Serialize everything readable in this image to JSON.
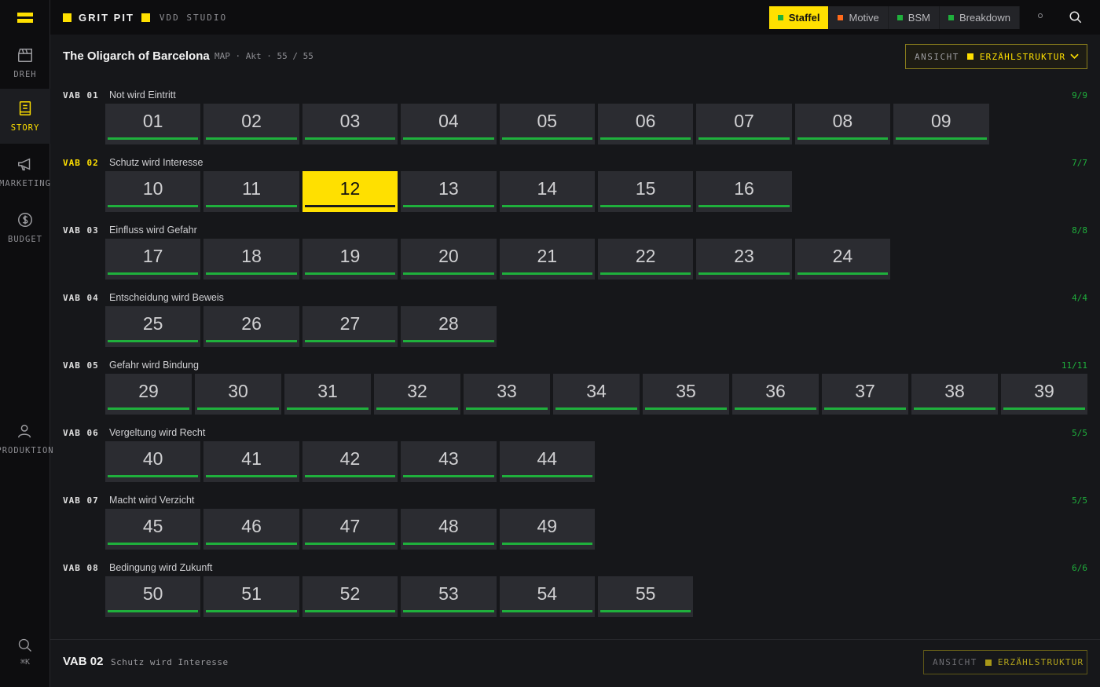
{
  "app": {
    "brand": "GRIT PIT",
    "studio": "VDD STUDIO"
  },
  "sidebar": {
    "items": [
      {
        "label": "DREH",
        "icon": "clapperboard-icon"
      },
      {
        "label": "STORY",
        "icon": "book-icon",
        "active": true
      },
      {
        "label": "MARKETING",
        "icon": "megaphone-icon"
      },
      {
        "label": "BUDGET",
        "icon": "dollar-circle-icon"
      },
      {
        "label": "PRODUKTION",
        "icon": "user-icon"
      }
    ],
    "search_label": "⌘K"
  },
  "tabs": [
    {
      "label": "Staffel",
      "dot": "#1fb03c",
      "active": true
    },
    {
      "label": "Motive",
      "dot": "#ff6a1a"
    },
    {
      "label": "BSM",
      "dot": "#1fb03c"
    },
    {
      "label": "Breakdown",
      "dot": "#1fb03c"
    }
  ],
  "header": {
    "title": "The Oligarch of Barcelona",
    "meta": "MAP · Akt · 55 / 55",
    "view_label": "ANSICHT",
    "view_value": "ERZÄHLSTRUKTUR"
  },
  "colors": {
    "accent": "#ffe000",
    "complete": "#1fb03c",
    "background": "#16171a"
  },
  "groups": [
    {
      "label": "VAB 01",
      "title": "Not wird Eintritt",
      "count": "9/9",
      "episodes": [
        "01",
        "02",
        "03",
        "04",
        "05",
        "06",
        "07",
        "08",
        "09"
      ]
    },
    {
      "label": "VAB 02",
      "title": "Schutz wird Interesse",
      "count": "7/7",
      "episodes": [
        "10",
        "11",
        "12",
        "13",
        "14",
        "15",
        "16"
      ],
      "current": true,
      "selected": "12"
    },
    {
      "label": "VAB 03",
      "title": "Einfluss wird Gefahr",
      "count": "8/8",
      "episodes": [
        "17",
        "18",
        "19",
        "20",
        "21",
        "22",
        "23",
        "24"
      ]
    },
    {
      "label": "VAB 04",
      "title": "Entscheidung wird Beweis",
      "count": "4/4",
      "episodes": [
        "25",
        "26",
        "27",
        "28"
      ]
    },
    {
      "label": "VAB 05",
      "title": "Gefahr wird Bindung",
      "count": "11/11",
      "episodes": [
        "29",
        "30",
        "31",
        "32",
        "33",
        "34",
        "35",
        "36",
        "37",
        "38",
        "39"
      ]
    },
    {
      "label": "VAB 06",
      "title": "Vergeltung wird Recht",
      "count": "5/5",
      "episodes": [
        "40",
        "41",
        "42",
        "43",
        "44"
      ]
    },
    {
      "label": "VAB 07",
      "title": "Macht wird Verzicht",
      "count": "5/5",
      "episodes": [
        "45",
        "46",
        "47",
        "48",
        "49"
      ]
    },
    {
      "label": "VAB 08",
      "title": "Bedingung wird Zukunft",
      "count": "6/6",
      "episodes": [
        "50",
        "51",
        "52",
        "53",
        "54",
        "55"
      ]
    }
  ],
  "footer": {
    "title": "VAB 02",
    "subtitle": "Schutz wird Interesse",
    "view_label": "ANSICHT",
    "view_value": "ERZÄHLSTRUKTUR"
  }
}
